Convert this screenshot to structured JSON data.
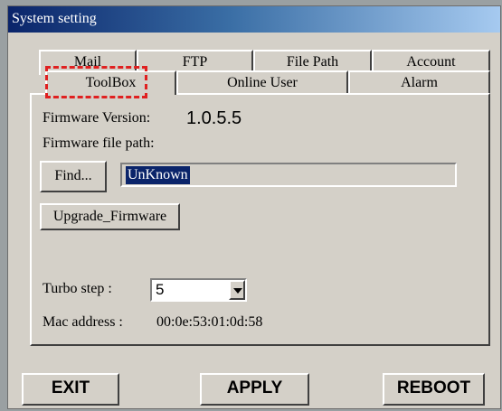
{
  "window": {
    "title": "System setting"
  },
  "tabs_back": [
    "Mail",
    "FTP",
    "File Path",
    "Account"
  ],
  "tabs_front": [
    "ToolBox",
    "Online User",
    "Alarm"
  ],
  "toolbox": {
    "firmware_version_label": "Firmware Version:",
    "firmware_version_value": "1.0.5.5",
    "firmware_path_label": "Firmware file path:",
    "find_label": "Find...",
    "path_value": "UnKnown",
    "upgrade_label": "Upgrade_Firmware",
    "turbo_label": "Turbo step :",
    "turbo_value": "5",
    "mac_label": "Mac address :",
    "mac_value": "00:0e:53:01:0d:58"
  },
  "buttons": {
    "exit": "EXIT",
    "apply": "APPLY",
    "reboot": "REBOOT"
  },
  "colors": {
    "annotation": "#e02020",
    "selection": "#0a246a"
  }
}
